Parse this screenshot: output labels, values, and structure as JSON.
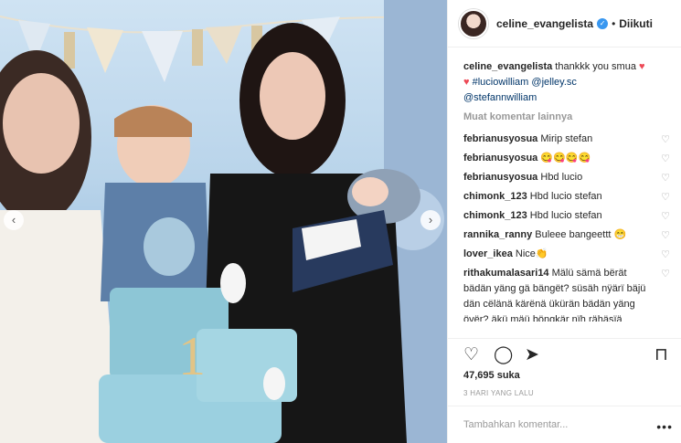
{
  "post": {
    "username": "celine_evangelista",
    "follow_label": "Diikuti",
    "dot": "•",
    "verified_mark": "✓"
  },
  "caption": {
    "username": "celine_evangelista",
    "text": "thankkk you smua",
    "heart1": "♥",
    "heart2": "♥",
    "tag1": "#luciowilliam",
    "tag2": "@jelley.sc",
    "tag3": "@stefannwilliam"
  },
  "more_comments": "Muat komentar lainnya",
  "comments": [
    {
      "user": "febrianusyosua",
      "text": "Mirip stefan"
    },
    {
      "user": "febrianusyosua",
      "text": "😋😋😋😋"
    },
    {
      "user": "febrianusyosua",
      "text": "Hbd lucio"
    },
    {
      "user": "chimonk_123",
      "text": "Hbd lucio stefan"
    },
    {
      "user": "chimonk_123",
      "text": "Hbd lucio stefan"
    },
    {
      "user": "rannika_ranny",
      "text": "Buleee bangeettt 😁"
    },
    {
      "user": "lover_ikea",
      "text": "Nice👏"
    },
    {
      "user": "rithakumalasari14",
      "text": "Mälü sämä bërät bädän yäng gä bängët? süsäh nÿärï bäjü dän cëlänä kärënä ükürän bädän yäng övër? äkü mäü böngkär nïh rähäsïä mënürünkän bërät bädän yäng ëfëktïf dän häsïlnÿä pün përmänën,"
    }
  ],
  "like_icon": "♡",
  "actions": {
    "like": "♡",
    "comment": "◯",
    "share": "➤",
    "save": "⊓"
  },
  "likes": "47,695 suka",
  "time": "3 HARI YANG LALU",
  "add_comment_placeholder": "Tambahkan komentar...",
  "more_dots": "•••",
  "carousel": {
    "left": "‹",
    "right": "›"
  }
}
